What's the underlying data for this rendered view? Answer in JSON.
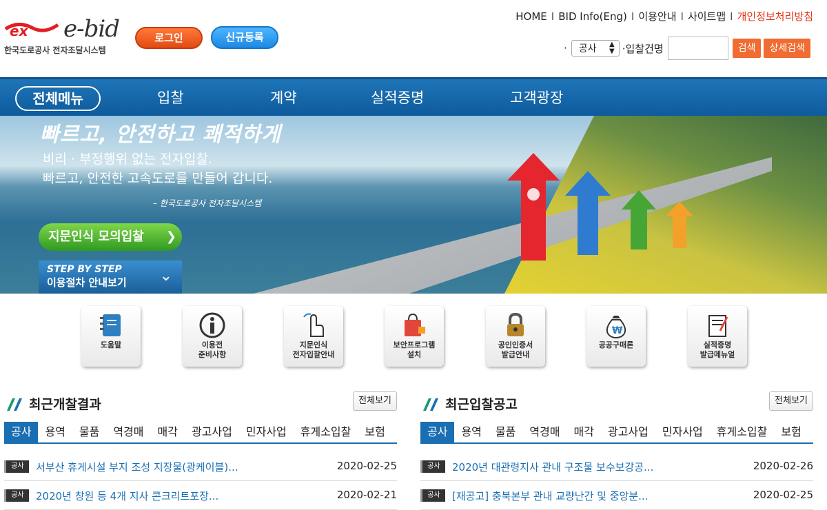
{
  "brand": {
    "logo_mark": "ex",
    "logo_word": "e-bid",
    "logo_sub": "한국도로공사 전자조달시스템"
  },
  "header": {
    "login": "로그인",
    "register": "신규등록",
    "util_links": [
      "HOME",
      "BID Info(Eng)",
      "이용안내",
      "사이트맵",
      "개인정보처리방침"
    ],
    "separator": "I",
    "search": {
      "bullet": "·",
      "type_value": "공사",
      "label": "·입찰건명",
      "input_value": "",
      "search_btn": "검색",
      "detail_btn": "상세검색"
    }
  },
  "nav": {
    "all": "전체메뉴",
    "items": [
      "입찰",
      "계약",
      "실적증명",
      "고객광장"
    ]
  },
  "banner": {
    "title": "빠르고, 안전하고 쾌적하게",
    "line1": "비리 · 부정행위 없는 전자입찰.",
    "line2": "빠르고, 안전한 고속도로를 만들어 갑니다.",
    "sign": "– 한국도로공사 전자조달시스템",
    "finger_btn": "지문인식 모의입찰",
    "step_top": "STEP BY STEP",
    "step_bottom": "이용절차 안내보기"
  },
  "quick_icons": [
    {
      "icon": "notebook-icon",
      "label": "도움말"
    },
    {
      "icon": "info-icon",
      "label": "이용전\n준비사항"
    },
    {
      "icon": "fingerprint-icon",
      "label": "지문인식\n전자입찰안내"
    },
    {
      "icon": "security-bag-icon",
      "label": "보안프로그램\n설치"
    },
    {
      "icon": "lock-icon",
      "label": "공인인증서\n발급안내"
    },
    {
      "icon": "money-bag-icon",
      "label": "공공구매론"
    },
    {
      "icon": "certificate-icon",
      "label": "실적증명\n발급메뉴얼"
    }
  ],
  "colors": {
    "accent_blue": "#1a6fb3",
    "accent_orange": "#f06c32",
    "privacy_red": "#e63312"
  },
  "left_panel": {
    "title": "최근개찰결과",
    "more": "전체보기",
    "tabs": [
      "공사",
      "용역",
      "물품",
      "역경매",
      "매각",
      "광고사업",
      "민자사업",
      "휴게소입찰",
      "보험"
    ],
    "rows": [
      {
        "badge": "공사",
        "title": "서부산 휴게시설 부지 조성 지장물(광케이블)...",
        "date": "2020-02-25"
      },
      {
        "badge": "공사",
        "title": "2020년 창원 등 4개 지사 콘크리트포장...",
        "date": "2020-02-21"
      }
    ]
  },
  "right_panel": {
    "title": "최근입찰공고",
    "more": "전체보기",
    "tabs": [
      "공사",
      "용역",
      "물품",
      "역경매",
      "매각",
      "광고사업",
      "민자사업",
      "휴게소입찰",
      "보험"
    ],
    "rows": [
      {
        "badge": "공사",
        "title": "2020년 대관령지사 관내 구조물 보수보강공...",
        "date": "2020-02-26"
      },
      {
        "badge": "공사",
        "title": "[재공고] 충북본부 관내 교량난간 및 중앙분...",
        "date": "2020-02-25"
      }
    ]
  }
}
